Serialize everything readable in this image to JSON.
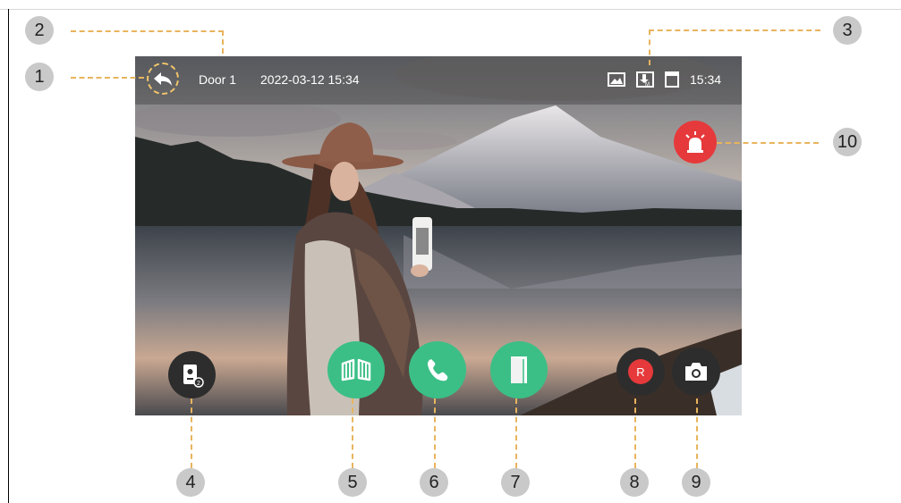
{
  "topbar": {
    "door_label": "Door 1",
    "datetime": "2022-03-12 15:34",
    "clock": "15:34"
  },
  "record_button_label": "R",
  "colors": {
    "accent_green": "#3bbf86",
    "alarm_red": "#e6393b",
    "callout_line": "#e8b45d",
    "dark_button": "#2d2d2d"
  },
  "icons": [
    "back-arrow-icon",
    "image-icon",
    "download-message-icon",
    "sd-card-icon",
    "alarm-siren-icon",
    "monitor-switch-icon",
    "gate-icon",
    "phone-icon",
    "door-icon",
    "record-icon",
    "camera-icon"
  ],
  "callouts": [
    "1",
    "2",
    "3",
    "4",
    "5",
    "6",
    "7",
    "8",
    "9",
    "10"
  ]
}
